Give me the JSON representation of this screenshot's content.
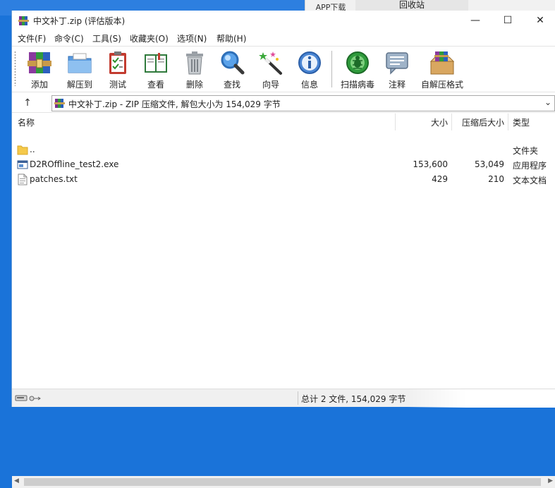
{
  "desktop": {
    "tab1": "APP下载",
    "tab2": "回收站"
  },
  "window": {
    "title": "中文补丁.zip (评估版本)",
    "controls": {
      "minimize": "—",
      "maximize": "☐",
      "close": "✕"
    }
  },
  "menu": [
    {
      "label": "文件(F)"
    },
    {
      "label": "命令(C)"
    },
    {
      "label": "工具(S)"
    },
    {
      "label": "收藏夹(O)"
    },
    {
      "label": "选项(N)"
    },
    {
      "label": "帮助(H)"
    }
  ],
  "toolbar": [
    {
      "label": "添加",
      "icon": "add-archive-icon"
    },
    {
      "label": "解压到",
      "icon": "extract-folder-icon"
    },
    {
      "label": "测试",
      "icon": "test-clipboard-icon"
    },
    {
      "label": "查看",
      "icon": "view-book-icon"
    },
    {
      "label": "删除",
      "icon": "trash-icon"
    },
    {
      "label": "查找",
      "icon": "magnifier-icon"
    },
    {
      "label": "向导",
      "icon": "wizard-wand-icon"
    },
    {
      "label": "信息",
      "icon": "info-icon"
    },
    {
      "label": "扫描病毒",
      "icon": "virus-scan-icon"
    },
    {
      "label": "注释",
      "icon": "comment-icon"
    },
    {
      "label": "自解压格式",
      "icon": "sfx-box-icon"
    }
  ],
  "address": {
    "up": "↑",
    "path": "中文补丁.zip - ZIP 压缩文件, 解包大小为 154,029 字节",
    "dropdown": "⌄"
  },
  "columns": {
    "name": "名称",
    "size": "大小",
    "packed": "压缩后大小",
    "type": "类型"
  },
  "files": [
    {
      "name": "..",
      "size": "",
      "packed": "",
      "type": "文件夹",
      "icon": "folder-icon"
    },
    {
      "name": "D2ROffline_test2.exe",
      "size": "153,600",
      "packed": "53,049",
      "type": "应用程序",
      "icon": "exe-icon"
    },
    {
      "name": "patches.txt",
      "size": "429",
      "packed": "210",
      "type": "文本文档",
      "icon": "text-file-icon"
    }
  ],
  "status": {
    "summary": "总计 2 文件, 154,029 字节"
  },
  "colors": {
    "desktop": "#1a73d9",
    "window_bg": "#ffffff",
    "status_bg": "#f0f0f0"
  }
}
